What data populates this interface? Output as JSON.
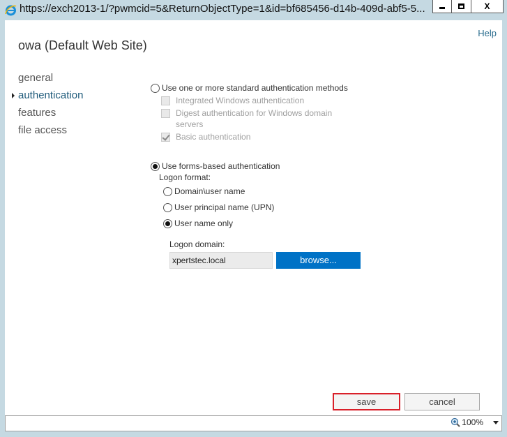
{
  "window": {
    "title": "https://exch2013-1/?pwmcid=5&ReturnObjectType=1&id=bf685456-d14b-409d-abf5-5...",
    "icon": "internet-explorer-icon",
    "controls": {
      "minimize": "minimize",
      "maximize": "maximize",
      "close": "X"
    }
  },
  "header": {
    "help_label": "Help",
    "page_title": "owa (Default Web Site)"
  },
  "nav": {
    "items": [
      {
        "label": "general",
        "active": false
      },
      {
        "label": "authentication",
        "active": true
      },
      {
        "label": "features",
        "active": false
      },
      {
        "label": "file access",
        "active": false
      }
    ]
  },
  "auth": {
    "standard_option": {
      "label": "Use one or more standard authentication methods",
      "selected": false
    },
    "standard_methods": [
      {
        "label": "Integrated Windows authentication",
        "checked": false,
        "disabled": true
      },
      {
        "label": "Digest authentication for Windows domain",
        "label_line2": "servers",
        "checked": false,
        "disabled": true
      },
      {
        "label": "Basic authentication",
        "checked": true,
        "disabled": true
      }
    ],
    "forms_option": {
      "label": "Use forms-based authentication",
      "selected": true
    },
    "logon_format_label": "Logon format:",
    "logon_formats": [
      {
        "label": "Domain\\user name",
        "selected": false
      },
      {
        "label": "User principal name (UPN)",
        "selected": false
      },
      {
        "label": "User name only",
        "selected": true
      }
    ],
    "logon_domain_label": "Logon domain:",
    "logon_domain_value": "xpertstec.local",
    "browse_label": "browse..."
  },
  "footer": {
    "save_label": "save",
    "cancel_label": "cancel"
  },
  "statusbar": {
    "zoom_level": "100%"
  },
  "colors": {
    "accent": "#0072c6",
    "highlight_border": "#d9202a",
    "nav_active": "#1e5a7a",
    "frame": "#c5d9e2"
  }
}
